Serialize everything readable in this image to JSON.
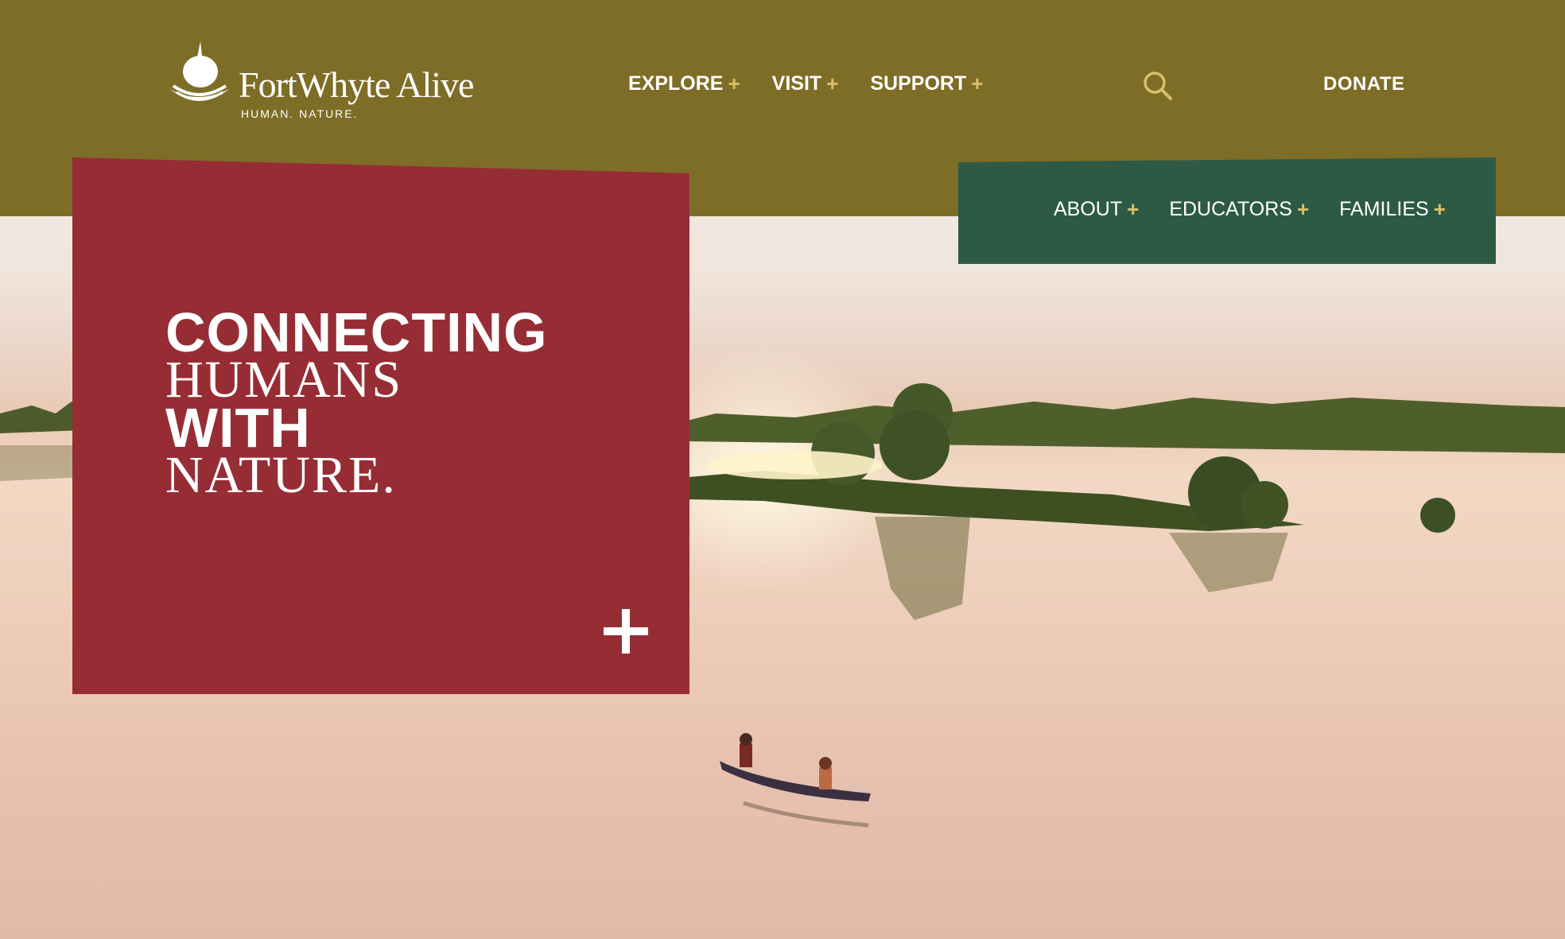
{
  "brand": {
    "name": "FortWhyte Alive",
    "tagline": "HUMAN. NATURE."
  },
  "main_nav": [
    {
      "label": "EXPLORE",
      "icon": "plus-icon"
    },
    {
      "label": "VISIT",
      "icon": "plus-icon"
    },
    {
      "label": "SUPPORT",
      "icon": "plus-icon"
    }
  ],
  "search": {
    "icon": "search-icon"
  },
  "donate": {
    "label": "DONATE"
  },
  "sub_nav": [
    {
      "label": "ABOUT",
      "icon": "plus-icon"
    },
    {
      "label": "EDUCATORS",
      "icon": "plus-icon"
    },
    {
      "label": "FAMILIES",
      "icon": "plus-icon"
    }
  ],
  "hero": {
    "headline": {
      "line1": "CONNECTING",
      "line2": "HUMANS",
      "line3": "WITH",
      "line4": "NATURE."
    },
    "expand_icon": "plus-icon"
  },
  "colors": {
    "header": "#7e6d27",
    "subnav": "#2e5a45",
    "panel": "#962d35",
    "accent": "#d9c069"
  }
}
